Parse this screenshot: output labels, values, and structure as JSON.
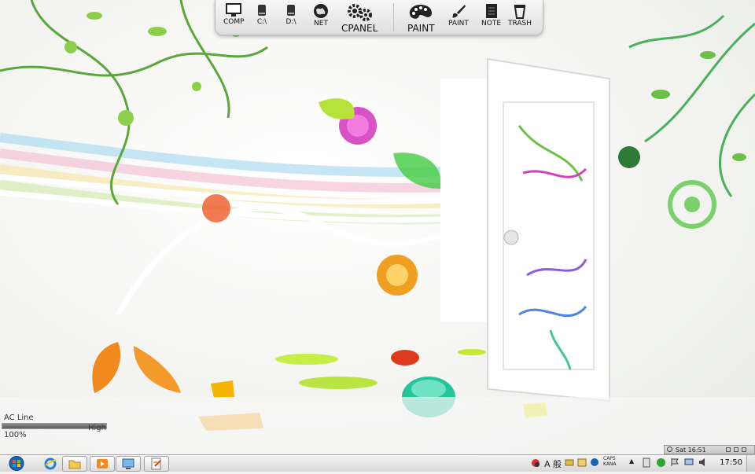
{
  "dock": {
    "items": [
      {
        "label": "COMP",
        "icon": "monitor-icon"
      },
      {
        "label": "C:\\",
        "icon": "drive-icon"
      },
      {
        "label": "D:\\",
        "icon": "drive-icon"
      },
      {
        "label": "NET",
        "icon": "globe-icon"
      },
      {
        "label": "CPANEL",
        "icon": "gears-icon"
      },
      {
        "label": "PAINT",
        "icon": "palette-icon"
      },
      {
        "label": "PAINT",
        "icon": "brush-icon"
      },
      {
        "label": "NOTE",
        "icon": "notepad-icon"
      },
      {
        "label": "TRASH",
        "icon": "trash-icon"
      }
    ]
  },
  "power": {
    "source": "AC Line",
    "percent_text": "100%",
    "level_text": "High",
    "level_fraction": 1.0
  },
  "clock_widget": {
    "datetime": "Sat 16:51"
  },
  "taskbar": {
    "start_icon": "windows-start-icon",
    "buttons": [
      {
        "icon": "internet-explorer-icon",
        "open": false
      },
      {
        "icon": "folder-icon",
        "open": true
      },
      {
        "icon": "media-player-icon",
        "open": true
      },
      {
        "icon": "monitor-window-icon",
        "open": true
      },
      {
        "icon": "document-edit-icon",
        "open": true
      }
    ],
    "tray": {
      "ime": "A 般",
      "caps": "CAPS",
      "kana": "KANA",
      "time": "17:50"
    }
  },
  "colors": {
    "accent_green": "#6cc04a",
    "accent_magenta": "#d43fc0",
    "accent_orange": "#f0a020",
    "accent_teal": "#25c49a"
  }
}
